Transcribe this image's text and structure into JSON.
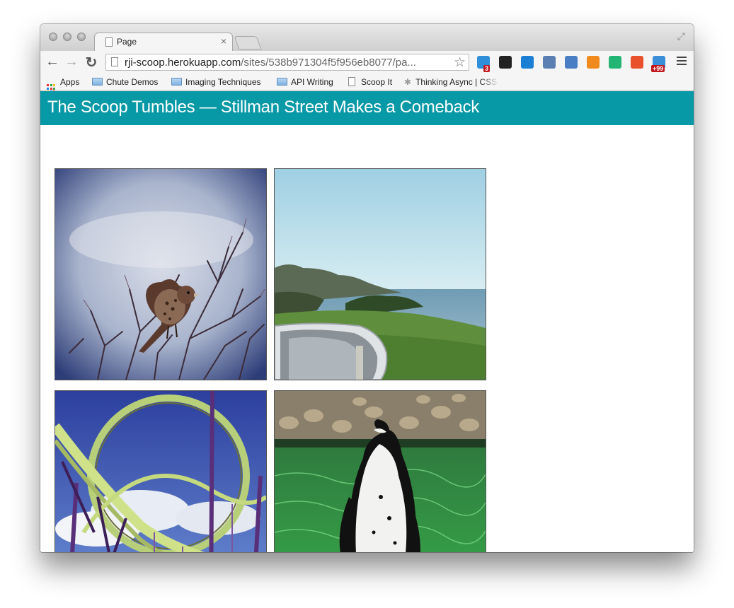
{
  "browser": {
    "tab_title": "Page",
    "tab_close": "×",
    "url_host": "rji-scoop.herokuapp.com",
    "url_path": "/sites/538b971304f5f956eb8077/pa...",
    "nav": {
      "back_icon": "←",
      "forward_icon": "→",
      "reload_icon": "↻",
      "star_icon": "☆",
      "fullscreen_icon": "⤢"
    },
    "extensions": [
      {
        "name": "todo-check-icon",
        "badge": "3",
        "color": "#2f8fd8"
      },
      {
        "name": "buffer-icon",
        "badge": "",
        "color": "#222222"
      },
      {
        "name": "phone-icon",
        "badge": "",
        "color": "#1b7fd6"
      },
      {
        "name": "window-icon",
        "badge": "",
        "color": "#5b7fb3"
      },
      {
        "name": "notes-icon",
        "badge": "",
        "color": "#4a7ec4"
      },
      {
        "name": "fire-icon",
        "badge": "",
        "color": "#f08a1c"
      },
      {
        "name": "pushbullet-icon",
        "badge": "",
        "color": "#22b573"
      },
      {
        "name": "clock-icon",
        "badge": "",
        "color": "#e8512b"
      },
      {
        "name": "plus-badge-icon",
        "badge": "+99",
        "color": "#3a8fd8"
      }
    ]
  },
  "bookmarks": [
    {
      "label": "Apps",
      "icon": "apps-icon"
    },
    {
      "label": "Chute Demos",
      "icon": "folder-icon"
    },
    {
      "label": "Imaging Techniques",
      "icon": "folder-icon"
    },
    {
      "label": "API Writing",
      "icon": "folder-icon"
    },
    {
      "label": "Scoop It",
      "icon": "page-icon"
    },
    {
      "label": "Thinking Async | CSS",
      "icon": "asterisk-icon"
    }
  ],
  "site": {
    "title": "The Scoop Tumbles — Stillman Street Makes a Comeback"
  },
  "photos": [
    {
      "subject": "sparrow on branches"
    },
    {
      "subject": "coastline from car mirror"
    },
    {
      "subject": "roller coaster loops"
    },
    {
      "subject": "penguin in water"
    }
  ]
}
